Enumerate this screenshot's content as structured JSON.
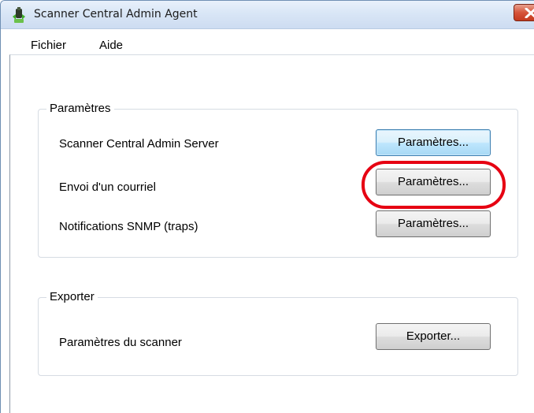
{
  "window": {
    "title": "Scanner Central Admin Agent",
    "close_symbol": "✕"
  },
  "menu": {
    "items": [
      "Fichier",
      "Aide"
    ]
  },
  "groups": {
    "parametres": {
      "title": "Paramètres",
      "rows": [
        {
          "label": "Scanner Central Admin Server",
          "button": "Paramètres..."
        },
        {
          "label": "Envoi d'un courriel",
          "button": "Paramètres..."
        },
        {
          "label": "Notifications SNMP (traps)",
          "button": "Paramètres..."
        }
      ]
    },
    "exporter": {
      "title": "Exporter",
      "rows": [
        {
          "label": "Paramètres du scanner",
          "button": "Exporter..."
        }
      ]
    }
  },
  "annotation": {
    "highlight_color": "#e60012"
  }
}
